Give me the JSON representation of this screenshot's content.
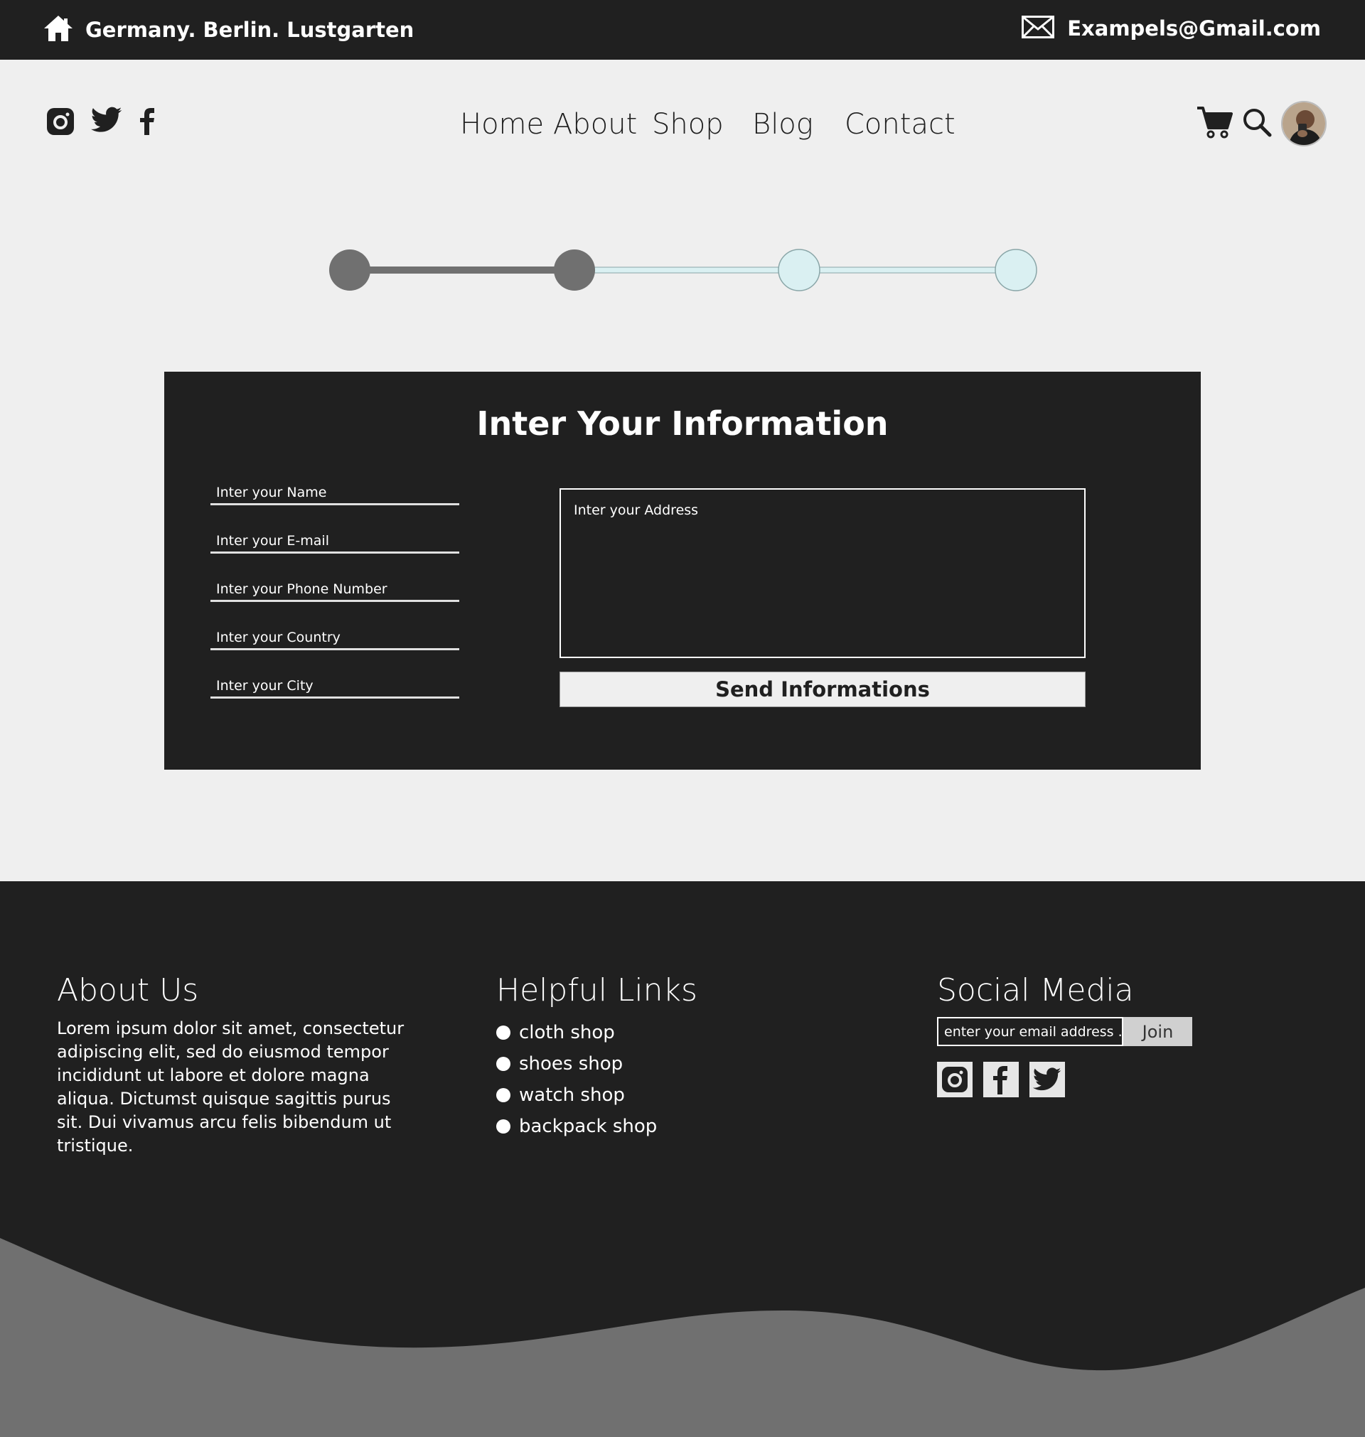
{
  "topbar": {
    "location": "Germany. Berlin. Lustgarten",
    "email": "Exampels@Gmail.com",
    "home_icon": "home-icon",
    "mail_icon": "mail-icon"
  },
  "header": {
    "social_icons": [
      "instagram-icon",
      "twitter-icon",
      "facebook-icon"
    ],
    "nav": [
      "Home",
      "About",
      "Shop",
      "Blog",
      "Contact"
    ],
    "right_icons": [
      "cart-icon",
      "search-icon",
      "avatar"
    ]
  },
  "stepper": {
    "total_steps": 4,
    "completed_steps": 2,
    "colors": {
      "done": "#707070",
      "pending": "#daf0f2",
      "pending_border": "#8aa6a8"
    }
  },
  "form": {
    "title": "Inter Your Information",
    "fields": [
      {
        "placeholder": "Inter your Name"
      },
      {
        "placeholder": "Inter your E-mail"
      },
      {
        "placeholder": "Inter your Phone Number"
      },
      {
        "placeholder": "Inter your Country"
      },
      {
        "placeholder": "Inter your City"
      }
    ],
    "address_placeholder": "Inter your Address",
    "submit_label": "Send Informations"
  },
  "footer": {
    "about": {
      "title": "About Us",
      "text": "Lorem ipsum dolor sit amet, consectetur adipiscing elit, sed do eiusmod tempor incididunt ut labore et dolore magna aliqua. Dictumst quisque sagittis purus sit. Dui vivamus arcu felis bibendum ut tristique."
    },
    "links": {
      "title": "Helpful Links",
      "items": [
        "cloth shop",
        "shoes shop",
        "watch shop",
        "backpack shop"
      ]
    },
    "social": {
      "title": "Social Media",
      "email_placeholder": "enter your email address ...",
      "join_label": "Join",
      "icons": [
        "instagram-icon",
        "facebook-icon",
        "twitter-icon"
      ]
    }
  },
  "colors": {
    "dark": "#202020",
    "light": "#efefef",
    "wave": "#707070"
  }
}
